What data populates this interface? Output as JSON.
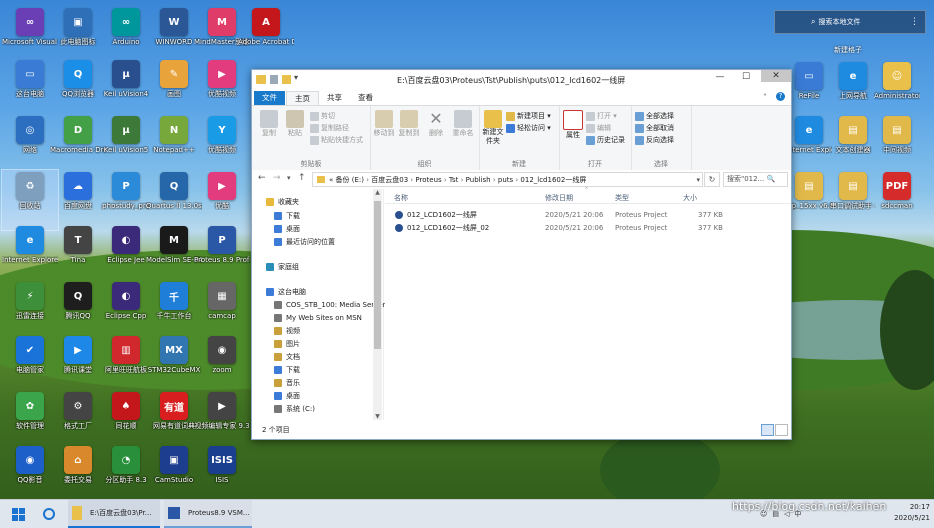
{
  "desktop": {
    "icons": [
      {
        "label": "Microsoft Visual Studio...",
        "color": "#6a3fb5",
        "glyph": "∞"
      },
      {
        "label": "此电脑图标",
        "color": "#2f6fb8",
        "glyph": "▣"
      },
      {
        "label": "Arduino",
        "color": "#00979c",
        "glyph": "∞"
      },
      {
        "label": "WINWORD",
        "color": "#2b5797",
        "glyph": "W"
      },
      {
        "label": "MindMaster思维导图",
        "color": "#e03c6a",
        "glyph": "M"
      },
      {
        "label": "Adobe Acrobat DC",
        "color": "#c4171c",
        "glyph": "A"
      },
      {
        "label": "这台电脑",
        "color": "#3a7bd5",
        "glyph": "▭"
      },
      {
        "label": "QQ浏览器",
        "color": "#1b8fe8",
        "glyph": "Q"
      },
      {
        "label": "Keil uVision4",
        "color": "#2a4f8f",
        "glyph": "μ"
      },
      {
        "label": "画图",
        "color": "#e8a33a",
        "glyph": "✎"
      },
      {
        "label": "优酷视频",
        "color": "#e23c7e",
        "glyph": "▶"
      },
      {
        "label": "网络",
        "color": "#2c6fc0",
        "glyph": "◎"
      },
      {
        "label": "Macromedia Dreamwea...",
        "color": "#43a047",
        "glyph": "D"
      },
      {
        "label": "Keil uVision5",
        "color": "#3d7a3a",
        "glyph": "μ"
      },
      {
        "label": "Notepad++",
        "color": "#76a83c",
        "glyph": "N"
      },
      {
        "label": "优酷视频",
        "color": "#1a9be6",
        "glyph": "Y"
      },
      {
        "label": "回收站",
        "color": "#7f9fbf",
        "glyph": "♻"
      },
      {
        "label": "百度网盘",
        "color": "#2a6fdb",
        "glyph": "☁"
      },
      {
        "label": "phpstudy_pro",
        "color": "#2b8bd8",
        "glyph": "P"
      },
      {
        "label": "Quartus II 13.0sp1 (64...",
        "color": "#2567a8",
        "glyph": "Q"
      },
      {
        "label": "优酷",
        "color": "#e23c7e",
        "glyph": "▶"
      },
      {
        "label": "Internet Explorer",
        "color": "#1f8be0",
        "glyph": "e"
      },
      {
        "label": "Tina",
        "color": "#444444",
        "glyph": "T"
      },
      {
        "label": "Eclipse Jee",
        "color": "#3b2a7a",
        "glyph": "◐"
      },
      {
        "label": "ModelSim SE-64 10.4",
        "color": "#1a1a1a",
        "glyph": "M"
      },
      {
        "label": "Proteus 8.9 Professional",
        "color": "#2a58a6",
        "glyph": "P"
      },
      {
        "label": "迅雷连接",
        "color": "#3d8f3a",
        "glyph": "⚡"
      },
      {
        "label": "腾讯QQ",
        "color": "#1e1e1e",
        "glyph": "Q"
      },
      {
        "label": "Eclipse Cpp",
        "color": "#3b2a7a",
        "glyph": "◐"
      },
      {
        "label": "千牛工作台",
        "color": "#1f7fd8",
        "glyph": "千"
      },
      {
        "label": "camcap",
        "color": "#666666",
        "glyph": "▦"
      },
      {
        "label": "电脑管家",
        "color": "#1a73d9",
        "glyph": "✔"
      },
      {
        "label": "腾讯课堂",
        "color": "#1d88e8",
        "glyph": "▶"
      },
      {
        "label": "阿里旺旺航板",
        "color": "#d0282d",
        "glyph": "▥"
      },
      {
        "label": "STM32CubeMX",
        "color": "#3276b1",
        "glyph": "MX"
      },
      {
        "label": "zoom",
        "color": "#444444",
        "glyph": "◉"
      },
      {
        "label": "软件管理",
        "color": "#3aa54a",
        "glyph": "✿"
      },
      {
        "label": "格式工厂",
        "color": "#444444",
        "glyph": "⚙"
      },
      {
        "label": "同花顺",
        "color": "#c4171c",
        "glyph": "♠"
      },
      {
        "label": "网易有道词典",
        "color": "#d81e1e",
        "glyph": "有道"
      },
      {
        "label": "视频编辑专家 9.3",
        "color": "#444444",
        "glyph": "▶"
      },
      {
        "label": "QQ影音",
        "color": "#1c5fc9",
        "glyph": "◉"
      },
      {
        "label": "委托交易",
        "color": "#d9892b",
        "glyph": "⌂"
      },
      {
        "label": "分区助手 8.3",
        "color": "#2a8f3a",
        "glyph": "◔"
      },
      {
        "label": "CamStudio",
        "color": "#1d3d8f",
        "glyph": "▣"
      },
      {
        "label": "ISIS",
        "color": "#1a3f8f",
        "glyph": "ISIS"
      },
      {
        "label": "Proteus 8.9 Professional",
        "color": "#3a6abf",
        "glyph": "P"
      }
    ],
    "right_icons": [
      {
        "label": "ReFile",
        "color": "#3a7bd5",
        "glyph": "▭"
      },
      {
        "label": "上网导航",
        "color": "#1f8be0",
        "glyph": "e"
      },
      {
        "label": "Administrator",
        "color": "#e8c04a",
        "glyph": "☺"
      },
      {
        "label": "Internet Explorer",
        "color": "#1f8be0",
        "glyph": "e"
      },
      {
        "label": "文本创建器",
        "color": "#e0b94a",
        "glyph": "▤"
      },
      {
        "label": "中间视频",
        "color": "#e0b94a",
        "glyph": "▤"
      },
      {
        "label": "isp_15xx v6.87E",
        "color": "#e0b94a",
        "glyph": "▤"
      },
      {
        "label": "串口调试助手 - 丁丁",
        "color": "#e0b94a",
        "glyph": "▤"
      },
      {
        "label": "sdccman",
        "color": "#d62b2b",
        "glyph": "PDF"
      }
    ],
    "top_right": {
      "search_text": "搜索本地文件",
      "new_box": "新建格子"
    },
    "watermark": "https://blog.csdn.net/kaihen"
  },
  "explorer": {
    "title": "E:\\百度云盘03\\Proteus\\Tst\\Publish\\puts\\012_lcd1602一线屏",
    "tabs": [
      "文件",
      "主页",
      "共享",
      "查看"
    ],
    "ribbon": {
      "clipboard": {
        "label": "剪贴板",
        "copy": "复制",
        "paste": "粘贴",
        "cut": "剪切",
        "copy_path": "复制路径",
        "paste_shortcut": "粘贴快捷方式"
      },
      "organize": {
        "label": "组织",
        "move_to": "移动到",
        "copy_to": "复制到",
        "delete": "删除",
        "rename": "重命名"
      },
      "new": {
        "label": "新建",
        "new_folder": "新建文件夹",
        "new_item": "新建项目 ▾",
        "easy_access": "轻松访问 ▾"
      },
      "open": {
        "label": "打开",
        "properties": "属性",
        "open": "打开 ▾",
        "edit": "编辑",
        "history": "历史记录"
      },
      "select": {
        "label": "选择",
        "select_all": "全部选择",
        "select_none": "全部取消",
        "invert": "反向选择"
      }
    },
    "address": {
      "path": [
        "«  备份 (E:)",
        "百度云盘03",
        "Proteus",
        "Tst",
        "Publish",
        "puts",
        "012_lcd1602一线屏"
      ],
      "search_placeholder": "搜索\"012...  🔍"
    },
    "nav": [
      {
        "label": "收藏夹",
        "color": "#e8b93a"
      },
      {
        "label": "下载",
        "color": "#3d7bd8"
      },
      {
        "label": "桌面",
        "color": "#3d7bd8"
      },
      {
        "label": "最近访问的位置",
        "color": "#3d7bd8"
      },
      {
        "label": "家庭组",
        "color": "#2a8fb8"
      },
      {
        "label": "这台电脑",
        "color": "#3d7bd8"
      },
      {
        "label": "COS_STB_100: Media Server",
        "color": "#777777"
      },
      {
        "label": "My Web Sites on MSN",
        "color": "#777777"
      },
      {
        "label": "视频",
        "color": "#c9a03a"
      },
      {
        "label": "图片",
        "color": "#c9a03a"
      },
      {
        "label": "文档",
        "color": "#c9a03a"
      },
      {
        "label": "下载",
        "color": "#3d7bd8"
      },
      {
        "label": "音乐",
        "color": "#c9a03a"
      },
      {
        "label": "桌面",
        "color": "#3d7bd8"
      },
      {
        "label": "系统 (C:)",
        "color": "#777777"
      }
    ],
    "columns": [
      "名称",
      "修改日期",
      "类型",
      "大小"
    ],
    "files": [
      {
        "name": "012_LCD1602一线屏",
        "date": "2020/5/21 20:06",
        "type": "Proteus Project",
        "size": "377 KB"
      },
      {
        "name": "012_LCD1602一线屏_02",
        "date": "2020/5/21 20:06",
        "type": "Proteus Project",
        "size": "377 KB"
      }
    ],
    "status": "2 个项目"
  },
  "taskbar": {
    "items": [
      {
        "label": "E:\\百度云盘03\\Pr...",
        "icon": "folder-icon"
      },
      {
        "label": "Proteus8.9 VSM...",
        "icon": "proteus-icon"
      }
    ],
    "time": "20:17",
    "date": "2020/5/21"
  }
}
